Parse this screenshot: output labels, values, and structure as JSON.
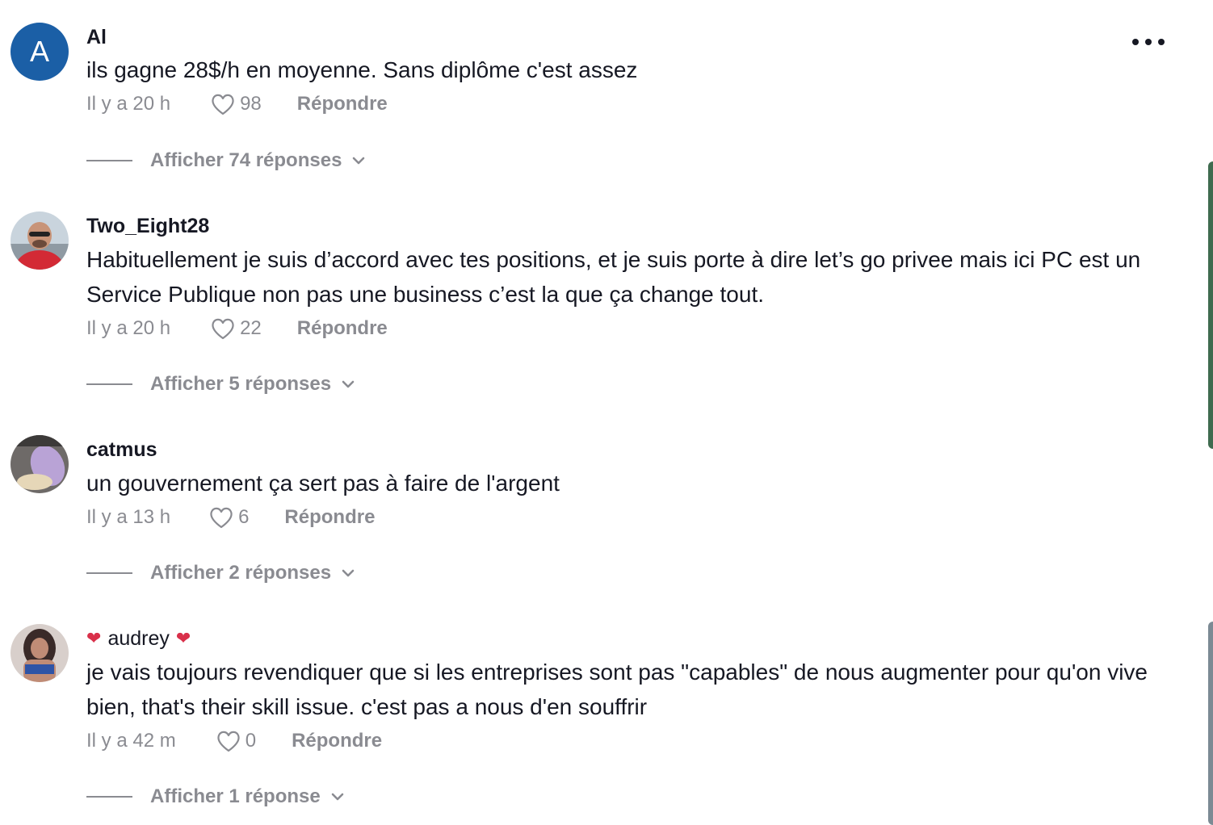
{
  "comments": [
    {
      "avatar_letter": "A",
      "username": "Al",
      "text": "ils gagne 28$/h en moyenne. Sans diplôme c'est assez",
      "time": "Il y a 20 h",
      "likes": "98",
      "reply_label": "Répondre",
      "view_replies": "Afficher 74 réponses"
    },
    {
      "username": "Two_Eight28",
      "text": "Habituellement je suis d’accord avec tes positions, et je suis porte à dire let’s go privee mais ici PC est un Service Publique non pas une business c’est la que ça change tout.",
      "time": "Il y a 20 h",
      "likes": "22",
      "reply_label": "Répondre",
      "view_replies": "Afficher 5 réponses"
    },
    {
      "username": "catmus",
      "text": "un gouvernement ça sert pas à faire de l'argent",
      "time": "Il y a 13 h",
      "likes": "6",
      "reply_label": "Répondre",
      "view_replies": "Afficher 2 réponses"
    },
    {
      "username": "audrey",
      "username_decoration": "❤",
      "text": "je vais toujours revendiquer que si les entreprises sont pas \"capables\" de nous augmenter pour qu'on vive bien, that's their skill issue. c'est pas a nous d'en souffrir",
      "time": "Il y a 42 m",
      "likes": "0",
      "reply_label": "Répondre",
      "view_replies": "Afficher 1 réponse"
    }
  ],
  "more_options_icon": "ellipsis-icon",
  "colors": {
    "text_primary": "#161823",
    "text_secondary": "#8a8b91",
    "avatar_blue": "#1b5fa6",
    "heart_red": "#d9304a"
  }
}
